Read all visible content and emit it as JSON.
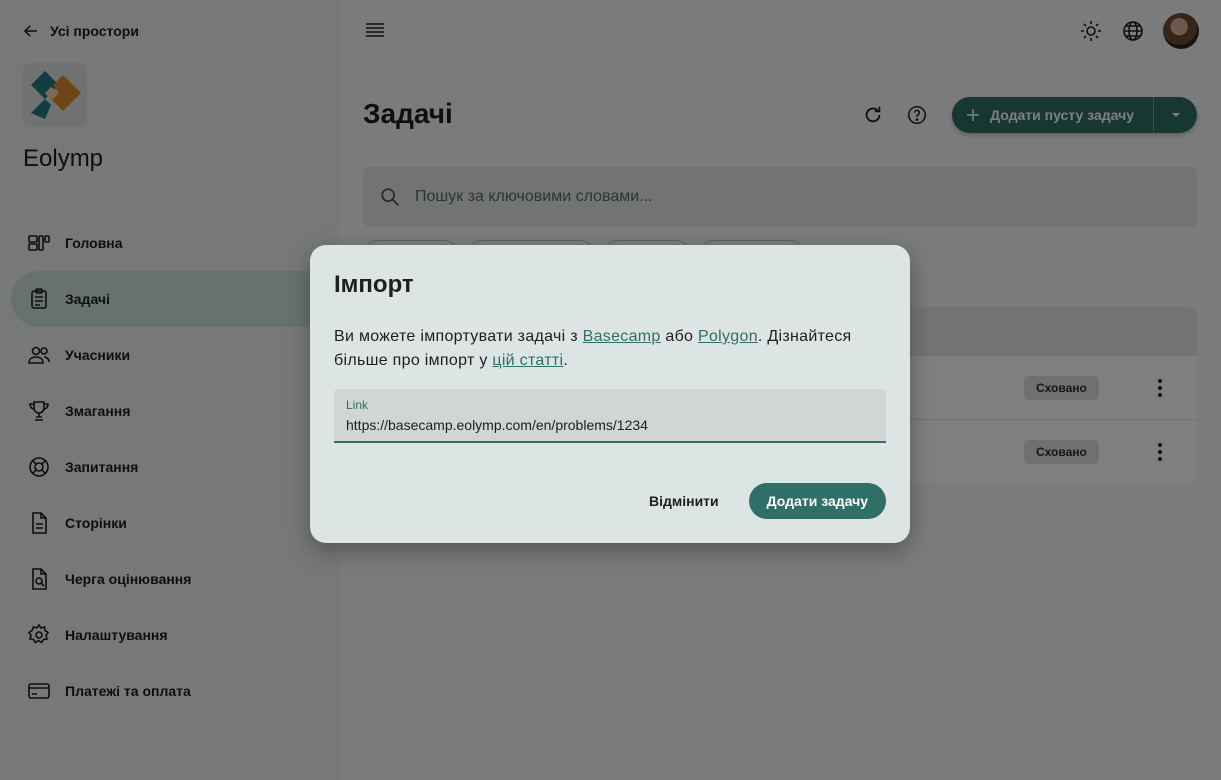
{
  "sidebar": {
    "back_label": "Усі простори",
    "brand": "Eolymp",
    "items": [
      {
        "label": "Головна",
        "icon": "dashboard-icon"
      },
      {
        "label": "Задачі",
        "icon": "clipboard-icon",
        "active": true
      },
      {
        "label": "Учасники",
        "icon": "people-icon"
      },
      {
        "label": "Змагання",
        "icon": "trophy-icon"
      },
      {
        "label": "Запитання",
        "icon": "help-circle-icon"
      },
      {
        "label": "Сторінки",
        "icon": "document-icon"
      },
      {
        "label": "Черга оцінювання",
        "icon": "document-search-icon"
      },
      {
        "label": "Налаштування",
        "icon": "gear-icon"
      },
      {
        "label": "Платежі та оплата",
        "icon": "credit-card-icon"
      }
    ]
  },
  "main": {
    "title": "Задачі",
    "add_button": "Додати пусту задачу",
    "search_placeholder": "Пошук за ключовими словами...",
    "rows": [
      {
        "status": "Сховано"
      },
      {
        "status": "Сховано"
      }
    ]
  },
  "dialog": {
    "title": "Імпорт",
    "text_before": "Ви можете імпортувати задачі з ",
    "link1": "Basecamp",
    "text_mid": " або ",
    "link2": "Polygon",
    "text_after": ". Дізнайтеся більше про імпорт у ",
    "link3": "цій статті",
    "text_end": ".",
    "field_label": "Link",
    "field_value": "https://basecamp.eolymp.com/en/problems/1234",
    "cancel_label": "Відмінити",
    "submit_label": "Додати задачу"
  },
  "colors": {
    "accent": "#2f6f67",
    "active_nav": "#cfe5df",
    "dialog_bg": "#dce5e3"
  }
}
